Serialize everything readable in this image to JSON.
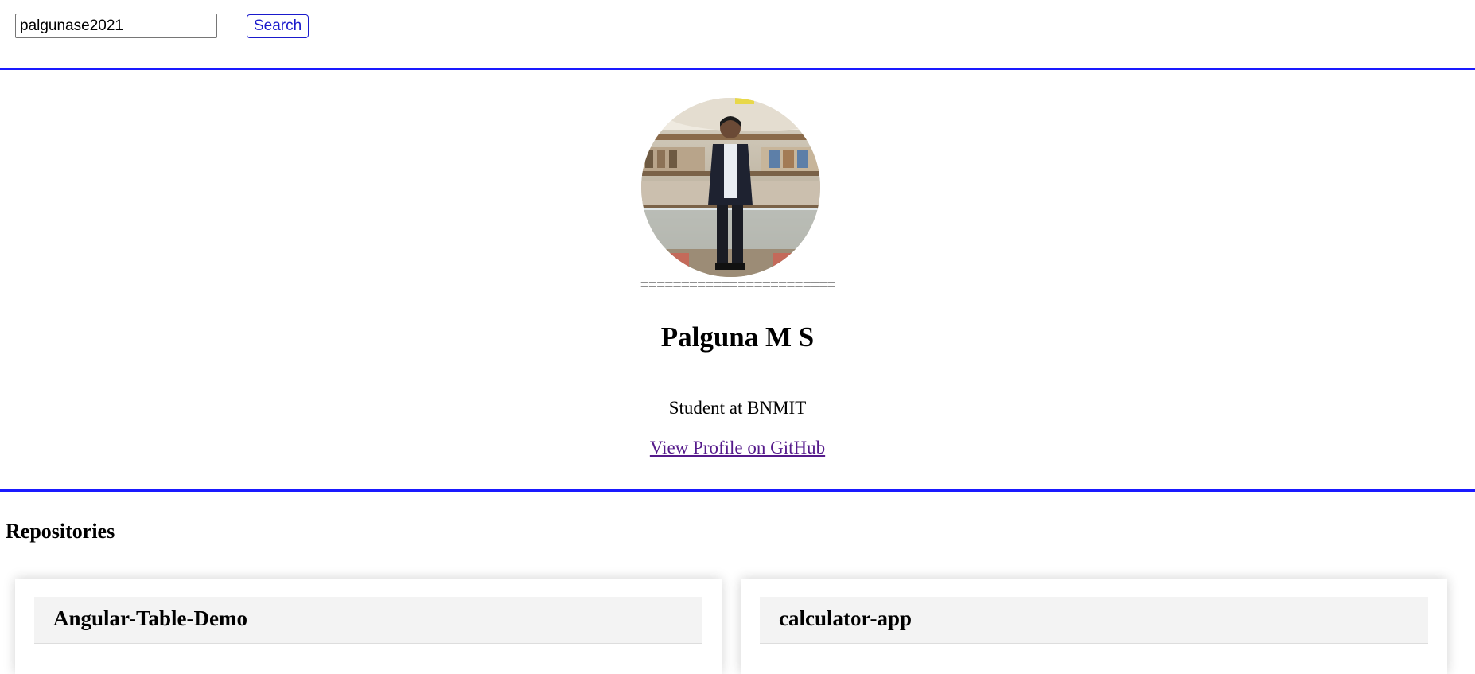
{
  "search": {
    "value": "palgunase2021",
    "button_label": "Search"
  },
  "profile": {
    "avatar_alt": "profile photo",
    "divider": "========================",
    "name": "Palguna M S",
    "bio": "Student at BNMIT",
    "link_text": "View Profile on GitHub"
  },
  "repositories": {
    "heading": "Repositories",
    "items": [
      {
        "name": "Angular-Table-Demo"
      },
      {
        "name": "calculator-app"
      }
    ]
  },
  "colors": {
    "accent_border": "#1a1aff",
    "button_text": "#1a1acc",
    "link_visited": "#551a8b",
    "card_header_bg": "#f3f3f3"
  }
}
